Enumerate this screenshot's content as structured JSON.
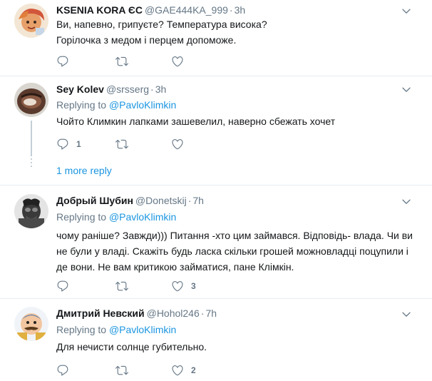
{
  "tweets": [
    {
      "name": "KSENIA KORA ЄС",
      "handle": "@GAE444KA_999",
      "time": "3h",
      "lines": [
        "Ви, напевно, грипуєте? Температура висока?",
        "Горілочка з медом і перцем допоможе."
      ],
      "reply_count": "",
      "retweet_count": "",
      "like_count": ""
    },
    {
      "name": "Sey Kolev",
      "handle": "@srsserg",
      "time": "3h",
      "replying_prefix": "Replying to",
      "replying_to": "@PavloKlimkin",
      "lines": [
        "Чойто Климкин лапками зашевелил, наверно сбежать хочет"
      ],
      "reply_count": "1",
      "retweet_count": "",
      "like_count": ""
    },
    {
      "name": "Добрый Шубин",
      "handle": "@Donetskij",
      "time": "7h",
      "replying_prefix": "Replying to",
      "replying_to": "@PavloKlimkin",
      "lines": [
        "чому раніше? Завжди))) Питання -хто цим займався. Відповідь- влада. Чи ви",
        "не були у владі. Скажіть будь ласка скільки грошей можновладці поцупили і",
        "де вони. Не вам критикою займатися, пане Клімкін."
      ],
      "reply_count": "",
      "retweet_count": "",
      "like_count": "3"
    },
    {
      "name": "Дмитрий Невский",
      "handle": "@Hohol246",
      "time": "7h",
      "replying_prefix": "Replying to",
      "replying_to": "@PavloKlimkin",
      "lines": [
        "Для нечисти солнце губительно."
      ],
      "reply_count": "",
      "retweet_count": "",
      "like_count": "2"
    }
  ],
  "more_reply": "1 more reply",
  "icons": [
    "reply-icon",
    "retweet-icon",
    "like-icon",
    "chevron-down-icon"
  ],
  "colors": {
    "link": "#1b95e0",
    "muted": "#657786",
    "divider": "#e6ecf0",
    "text": "#14171a"
  }
}
